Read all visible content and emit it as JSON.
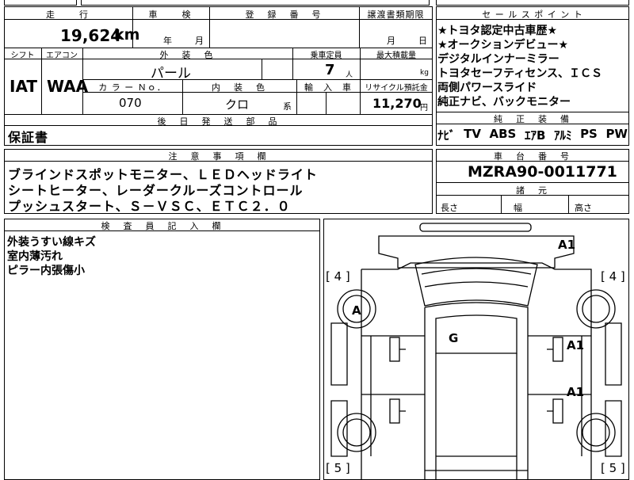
{
  "header": {
    "mileage_label": "走　　行",
    "inspection_label": "車　　検",
    "registration_label": "登　録　番　号",
    "transfer_deadline_label": "譲渡書類期限",
    "sales_points_label": "セ ー ル ス ポ イ ン ト"
  },
  "row1": {
    "mileage": "19,624",
    "mileage_unit": "km",
    "inspection_year": "年",
    "inspection_month": "月",
    "transfer_month": "月",
    "transfer_day": "日"
  },
  "row2_labels": {
    "shift": "シフト",
    "aircon": "エアコン",
    "exterior_color": "外　装　色",
    "capacity": "乗車定員",
    "max_load": "最大積載量"
  },
  "row2": {
    "shift": "IAT",
    "aircon": "WAA",
    "exterior_color": "パール",
    "capacity": "7",
    "capacity_unit": "人",
    "max_load_unit": "kg"
  },
  "row3_labels": {
    "color_no": "カ ラ ー Ｎｏ．",
    "interior_color": "内　装　色",
    "import": "輸　入　車",
    "recycle": "リサイクル預託金"
  },
  "row3": {
    "color_no": "070",
    "interior_color": "クロ",
    "interior_suffix": "系",
    "recycle_fee": "11,270",
    "recycle_unit": "円"
  },
  "sales_points": [
    "★トヨタ認定中古車歴★",
    "★オークションデビュー★",
    "デジタルインナーミラー",
    "トヨタセーフティセンス、ＩＣＳ",
    "両側パワースライド",
    "純正ナビ、バックモニター"
  ],
  "standard_equipment": {
    "label": "純　正　装　備",
    "items": [
      "ﾅﾋﾞ",
      "TV",
      "ABS",
      "ｴｱB",
      "ｱﾙﾐ",
      "PS",
      "PW"
    ]
  },
  "later_parts": {
    "label": "後　日　発　送　部　品",
    "value": "保証書"
  },
  "notes": {
    "label": "注　意　事　項　欄",
    "lines": [
      "ブラインドスポットモニター、ＬＥＤヘッドライト",
      "シートヒーター、レーダークルーズコントロール",
      "プッシュスタート、Ｓ－ＶＳＣ、ＥＴＣ２．０"
    ]
  },
  "chassis": {
    "label": "車　台　番　号",
    "value": "MZRA90-0011771"
  },
  "dimensions": {
    "label": "諸　元",
    "length": "長さ",
    "width": "幅",
    "height": "高さ"
  },
  "inspector": {
    "label": "検　査　員　記　入　欄",
    "lines": [
      "外装うすい線キズ",
      "室内薄汚れ",
      "ピラー内張傷小"
    ]
  },
  "diagram": {
    "marks": {
      "a1_top": "A1",
      "a_left": "A",
      "g_center": "G",
      "a1_right_front": "A1",
      "a1_right_rear": "A1"
    },
    "tire_brackets": {
      "front_left": "[ 4 ]",
      "front_right": "[ 4 ]",
      "rear_left": "[ 5 ]",
      "rear_right": "[ 5 ]"
    }
  }
}
